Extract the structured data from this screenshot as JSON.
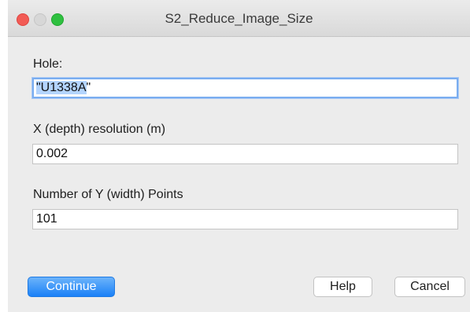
{
  "window": {
    "title": "S2_Reduce_Image_Size"
  },
  "form": {
    "hole": {
      "label": "Hole:",
      "value_selected": "\"U1338A",
      "value_rest": "\""
    },
    "x_resolution": {
      "label": "X (depth) resolution (m)",
      "value": "0.002"
    },
    "y_points": {
      "label": "Number of Y (width) Points",
      "value": "101"
    }
  },
  "buttons": {
    "continue": "Continue",
    "help": "Help",
    "cancel": "Cancel"
  },
  "colors": {
    "accent": "#1a81f7",
    "selection": "#b3d4fd",
    "close": "#f25b55",
    "maximize": "#2fc040"
  }
}
